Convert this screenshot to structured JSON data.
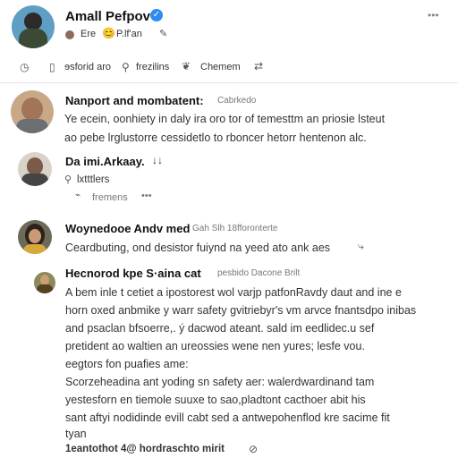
{
  "header": {
    "name": "Amall Pefpov",
    "sub1": "Ere",
    "emoji": "😊",
    "sub2": "P.lf'an",
    "more": "•••"
  },
  "action_bar": {
    "item1": "ɘsforid aro",
    "item2": "frezilins",
    "item3": "Chemem"
  },
  "comments": [
    {
      "name": "Nanport and mombatent:",
      "meta": "Cabrkedo",
      "lines": [
        "Ye ecein, oonhiety in daly ira oro tor of temesttm an priosie  lsteut",
        "ao pebe lrglustorre cessidetlo to rboncer hetorr hentenon alc."
      ]
    },
    {
      "name": "Da imi.Arkaay.",
      "mark": "↓↓",
      "sub": "lxtttlers",
      "extra": "fremens",
      "dots": "•••"
    },
    {
      "name": "Woynedooe Andv med",
      "meta": "Gah Slh 18fforonterte",
      "text": "Ceardbuting, ond desistor fuiynd na yeed ato ank aes"
    },
    {
      "name": "Hecnorod kpe S·aina cat",
      "meta": "pesbido Dacone Brilt",
      "lines": [
        "A bem inle t cetiet a ipostorest wol varjp patfonRavdy daut and ine e",
        "horn oxed anbmike y warr safety gvitriebyr's vm arvce fnantsdpo inibas",
        "and psaclan bfsoerre,. ý dacwod ateant. sald im eedlidec.u sef",
        "pretident ao waltien an ureossies wene nen yures; lesfe vou.",
        "eegtors fon puafies ame:",
        "Scorzeheadina ant yoding sn safety aer: walerdwardinand tam",
        "yestesforn en tiemole suuxe to sao,pladtont cacthoer abit his",
        "sant aftyi nodidinde evill cabt sed a antwepohenflod kre sacime fit",
        "tyan"
      ],
      "footer": "1eantothot 4@ hordraschto mirit"
    }
  ]
}
